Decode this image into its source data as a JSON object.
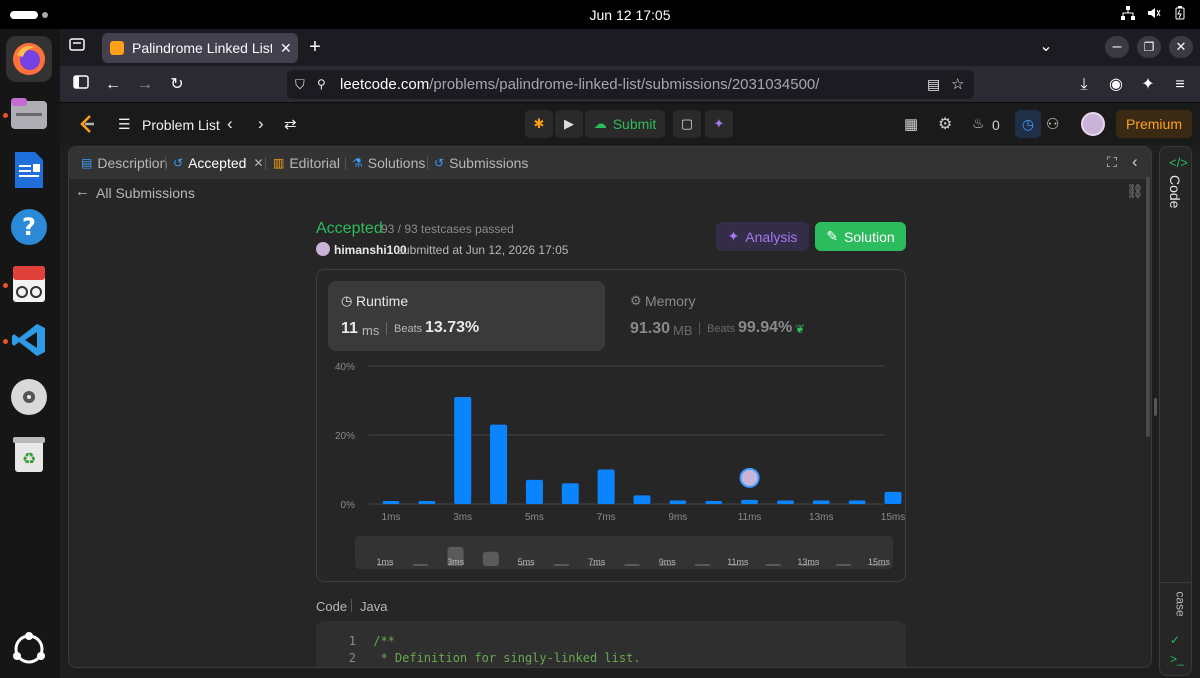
{
  "system": {
    "clock": "Jun 12  17:05"
  },
  "browser": {
    "tab_title": "Palindrome Linked List - L",
    "url_host": "leetcode.com",
    "url_path": "/problems/palindrome-linked-list/submissions/2031034500/"
  },
  "header": {
    "problem_list": "Problem List",
    "submit": "Submit",
    "streak_count": "0",
    "premium": "Premium"
  },
  "panel_tabs": {
    "description": "Description",
    "accepted": "Accepted",
    "editorial": "Editorial",
    "solutions": "Solutions",
    "submissions": "Submissions"
  },
  "side_tab": {
    "code": "Code",
    "testcase": "case"
  },
  "submission": {
    "back_label": "All Submissions",
    "status": "Accepted",
    "testcases": "93 / 93 testcases passed",
    "user": "himanshi100",
    "submitted_at": "submitted at Jun 12, 2026 17:05",
    "analysis_button": "Analysis",
    "solution_button": "Solution"
  },
  "runtime": {
    "label": "Runtime",
    "value": "11",
    "unit": "ms",
    "beats_label": "Beats",
    "beats": "13.73%"
  },
  "memory": {
    "label": "Memory",
    "value": "91.30",
    "unit": "MB",
    "beats_label": "Beats",
    "beats": "99.94%"
  },
  "code": {
    "label": "Code",
    "language": "Java",
    "lines": [
      {
        "num": "1",
        "text": "/**"
      },
      {
        "num": "2",
        "text": " * Definition for singly-linked list."
      }
    ]
  },
  "colors": {
    "accent_green": "#2cbb5d",
    "bar_blue": "#0a84ff",
    "premium_orange": "#ffa116",
    "analysis_purple": "#a678f2"
  },
  "chart_data": {
    "type": "bar",
    "categories": [
      "1ms",
      "2ms",
      "3ms",
      "4ms",
      "5ms",
      "6ms",
      "7ms",
      "8ms",
      "9ms",
      "10ms",
      "11ms",
      "12ms",
      "13ms",
      "14ms",
      "15ms"
    ],
    "values": [
      0.5,
      0.5,
      31,
      23,
      7,
      6,
      10,
      2.5,
      1,
      0.8,
      1.2,
      1,
      1,
      1,
      3.5
    ],
    "tick_labels": [
      "1ms",
      "3ms",
      "5ms",
      "7ms",
      "9ms",
      "11ms",
      "13ms",
      "15ms"
    ],
    "y_ticks": [
      "40%",
      "20%",
      "0%"
    ],
    "ylim": [
      0,
      40
    ],
    "highlight_category": "11ms",
    "minimap_labels": [
      "1ms",
      "3ms",
      "5ms",
      "7ms",
      "9ms",
      "11ms",
      "13ms",
      "15ms"
    ],
    "minimap_values": [
      0.5,
      0.5,
      31,
      23,
      0.3,
      0.3,
      0.3,
      0.3,
      0.3,
      0.3,
      0.3,
      0.3,
      0.3,
      0.3,
      0.3
    ],
    "grid": true
  }
}
